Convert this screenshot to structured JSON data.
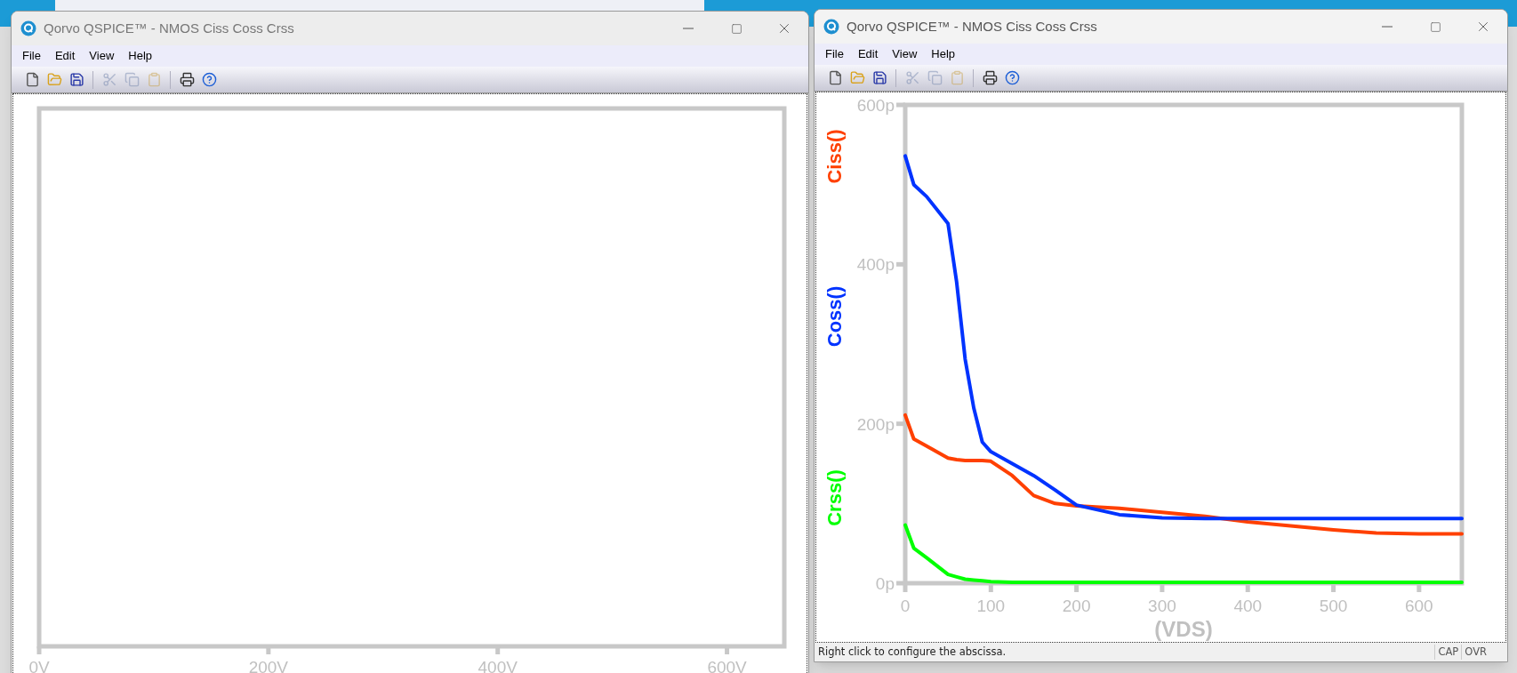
{
  "windows": [
    {
      "title": "Qorvo QSPICE™ - NMOS Ciss Coss Crss",
      "active": false,
      "menu": [
        "File",
        "Edit",
        "View",
        "Help"
      ],
      "toolbar": [
        {
          "kind": "new",
          "disabled": false
        },
        {
          "kind": "open",
          "disabled": false
        },
        {
          "kind": "save",
          "disabled": false
        },
        {
          "kind": "cut",
          "disabled": true
        },
        {
          "kind": "copy",
          "disabled": true
        },
        {
          "kind": "paste",
          "disabled": true
        },
        {
          "kind": "print",
          "disabled": false
        },
        {
          "kind": "help",
          "disabled": false
        }
      ],
      "plot": {
        "x_ticks": [
          "0V",
          "200V",
          "400V",
          "600V"
        ]
      }
    },
    {
      "title": "Qorvo QSPICE™ - NMOS Ciss Coss Crss",
      "active": true,
      "menu": [
        "File",
        "Edit",
        "View",
        "Help"
      ],
      "toolbar": [
        {
          "kind": "new",
          "disabled": false
        },
        {
          "kind": "open",
          "disabled": false
        },
        {
          "kind": "save",
          "disabled": false
        },
        {
          "kind": "cut",
          "disabled": true
        },
        {
          "kind": "copy",
          "disabled": true
        },
        {
          "kind": "paste",
          "disabled": true
        },
        {
          "kind": "print",
          "disabled": false
        },
        {
          "kind": "help",
          "disabled": false
        }
      ],
      "plot": {
        "chart_data": {
          "type": "line",
          "xlabel": "(VDS)",
          "x": [
            0,
            10,
            25,
            50,
            60,
            70,
            80,
            90,
            100,
            125,
            150,
            175,
            200,
            250,
            300,
            350,
            400,
            450,
            500,
            550,
            600,
            650
          ],
          "series": [
            {
              "name": "Ciss()",
              "color": "#ff4000",
              "values": [
                211,
                181,
                172,
                157,
                155,
                154,
                154,
                154,
                153,
                135,
                110,
                100,
                97,
                94,
                89,
                84,
                77,
                72,
                67,
                63,
                62,
                62
              ]
            },
            {
              "name": "Coss()",
              "color": "#0033ff",
              "values": [
                536,
                500,
                485,
                451,
                378,
                281,
                220,
                177,
                165,
                150,
                135,
                117,
                98,
                86,
                82,
                81,
                81,
                81,
                81,
                81,
                81,
                81
              ]
            },
            {
              "name": "Crss()",
              "color": "#00ff00",
              "values": [
                73,
                44,
                32,
                11,
                8,
                5,
                4,
                3,
                2,
                1,
                1,
                1,
                1,
                1,
                1,
                1,
                1,
                1,
                1,
                1,
                1,
                1
              ]
            }
          ],
          "xlim": [
            0,
            650
          ],
          "ylim": [
            0,
            600
          ],
          "xticks": [
            0,
            100,
            200,
            300,
            400,
            500,
            600
          ],
          "yticks": [
            {
              "value": 0,
              "label": "0p"
            },
            {
              "value": 200,
              "label": "200p"
            },
            {
              "value": 400,
              "label": "400p"
            },
            {
              "value": 600,
              "label": "600p"
            }
          ]
        }
      },
      "status_bar": {
        "text": "Right click to configure the abscissa.",
        "indicators": [
          "CAP",
          "OVR"
        ]
      }
    }
  ]
}
